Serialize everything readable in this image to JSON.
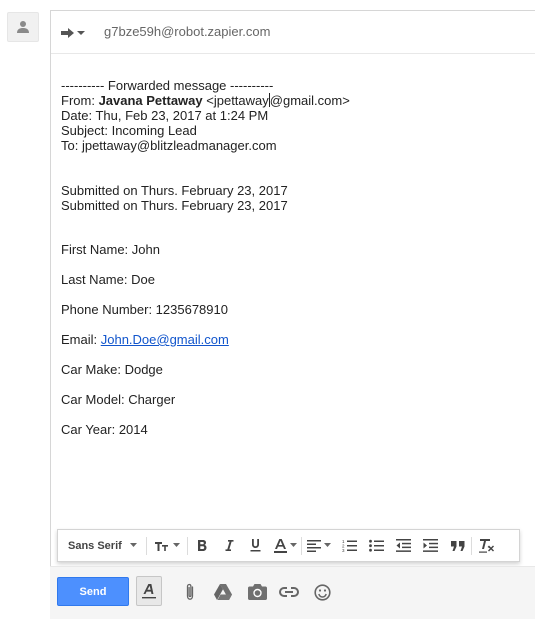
{
  "to_field": {
    "recipient": "g7bze59h@robot.zapier.com"
  },
  "message": {
    "forward_header": "---------- Forwarded message ----------",
    "from_prefix": "From: ",
    "from_name": "Javana Pettaway",
    "from_email_part1": " <jpettaway",
    "from_email_part2": "@gmail.com>",
    "date_line": "Date: Thu, Feb 23, 2017 at 1:24 PM",
    "subject_line": "Subject: Incoming Lead",
    "to_line": "To: jpettaway@blitzleadmanager.com",
    "submitted_line_1": "Submitted on Thurs. February 23, 2017",
    "submitted_line_2": "Submitted on Thurs. February 23, 2017",
    "first_name": "First Name: John",
    "last_name": "Last Name: Doe",
    "phone": "Phone Number: 1235678910",
    "email_label": "Email: ",
    "email_value": "John.Doe@gmail.com",
    "car_make": "Car Make: Dodge",
    "car_model": "Car Model: Charger",
    "car_year": "Car Year: 2014"
  },
  "format_toolbar": {
    "font_family": "Sans Serif"
  },
  "bottom_toolbar": {
    "send_label": "Send"
  },
  "colors": {
    "send_blue": "#4d90fe",
    "link_blue": "#1155cc",
    "icon_gray": "#777777"
  },
  "icons": [
    "avatar-icon",
    "reply-forward-icon",
    "font-size-icon",
    "bold-icon",
    "italic-icon",
    "underline-icon",
    "text-color-icon",
    "align-icon",
    "numbered-list-icon",
    "bulleted-list-icon",
    "indent-less-icon",
    "indent-more-icon",
    "quote-icon",
    "remove-formatting-icon",
    "formatting-options-icon",
    "attach-icon",
    "drive-icon",
    "photo-icon",
    "link-icon",
    "emoji-icon"
  ]
}
